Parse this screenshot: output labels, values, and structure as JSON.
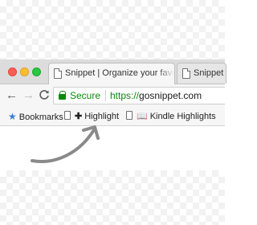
{
  "window": {
    "controls": [
      "close",
      "minimize",
      "maximize"
    ]
  },
  "tabs": [
    {
      "label": "Snippet | Organize your favorites",
      "active": true,
      "icon": "document-icon"
    },
    {
      "label": "Snippet",
      "active": false,
      "icon": "document-icon"
    }
  ],
  "toolbar": {
    "back": "←",
    "forward": "→",
    "reload": "C"
  },
  "omnibox": {
    "security_label": "Secure",
    "url_scheme": "https://",
    "url_host": "gosnippet.com"
  },
  "bookmarks": {
    "root_label": "Bookmarks",
    "items": [
      {
        "label": "Highlight",
        "icon": "plus-icon"
      },
      {
        "label": "Kindle Highlights",
        "icon": "book-icon"
      }
    ]
  },
  "colors": {
    "secure_green": "#0a8a0a",
    "star_blue": "#3b7ddd",
    "arrow_gray": "#8a8a8a"
  }
}
